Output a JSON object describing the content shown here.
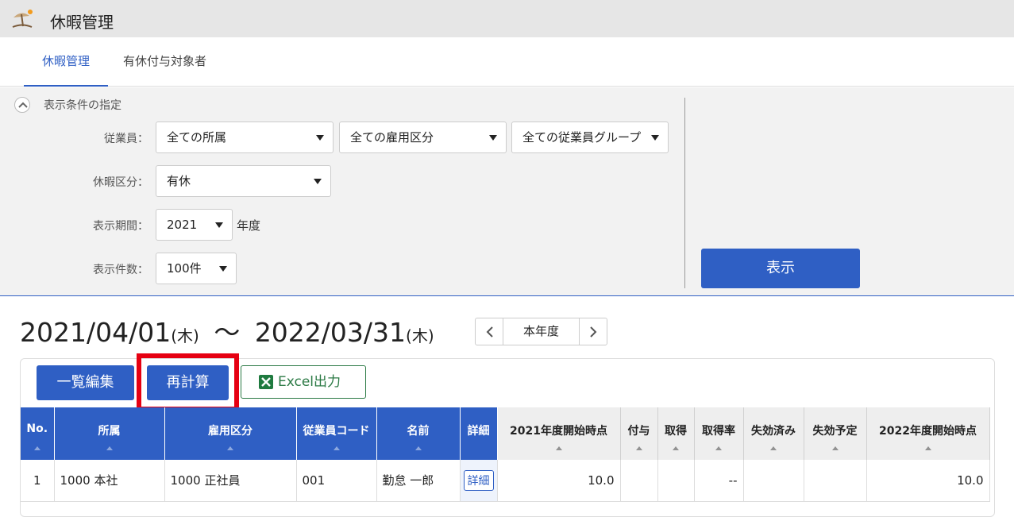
{
  "app": {
    "title": "休暇管理",
    "icon": "beach-umbrella-icon"
  },
  "tabs": [
    {
      "label": "休暇管理",
      "active": true
    },
    {
      "label": "有休付与対象者",
      "active": false
    }
  ],
  "filter": {
    "title": "表示条件の指定",
    "employee_label": "従業員：",
    "dept_select": "全ての所属",
    "employment_select": "全ての雇用区分",
    "group_select": "全ての従業員グループ",
    "leave_type_label": "休暇区分：",
    "leave_type_select": "有休",
    "period_label": "表示期間：",
    "year_select": "2021",
    "year_unit": "年度",
    "count_label": "表示件数：",
    "count_select": "100件",
    "show_button": "表示"
  },
  "period": {
    "start": "2021/04/01",
    "start_dow": "(木)",
    "tilde": "〜",
    "end": "2022/03/31",
    "end_dow": "(木)",
    "current_label": "本年度"
  },
  "actions": {
    "bulk_edit": "一覧編集",
    "recalc": "再計算",
    "excel": "Excel出力"
  },
  "table": {
    "headers": [
      "No.",
      "所属",
      "雇用区分",
      "従業員コード",
      "名前",
      "詳細",
      "2021年度開始時点",
      "付与",
      "取得",
      "取得率",
      "失効済み",
      "失効予定",
      "2022年度開始時点"
    ],
    "rows": [
      {
        "no": "1",
        "dept": "1000 本社",
        "employment": "1000 正社員",
        "code": "001",
        "name": "勤怠 一郎",
        "detail": "詳細",
        "start_balance": "10.0",
        "grant": "",
        "taken": "",
        "rate": "--",
        "expired": "",
        "to_expire": "",
        "next_balance": "10.0"
      }
    ]
  },
  "colors": {
    "accent": "#2f5fc4",
    "highlight": "#e60012",
    "excel": "#2c7a45"
  }
}
